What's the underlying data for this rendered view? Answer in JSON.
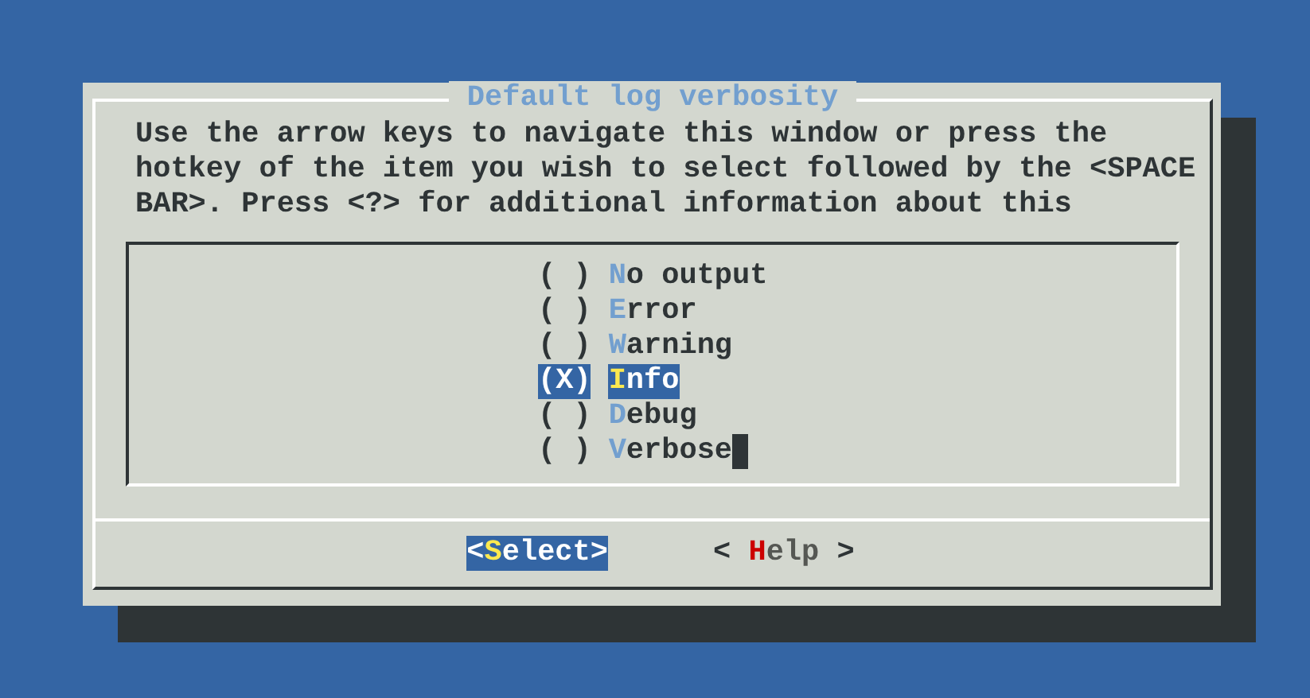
{
  "dialog": {
    "title": "Default log verbosity",
    "instructions": [
      "Use the arrow keys to navigate this window or press the",
      "hotkey of the item you wish to select followed by the <SPACE",
      "BAR>. Press <?> for additional information about this"
    ],
    "items": [
      {
        "marker": "( )",
        "label": "No output",
        "selected": false
      },
      {
        "marker": "( )",
        "label": "Error",
        "selected": false
      },
      {
        "marker": "( )",
        "label": "Warning",
        "selected": false
      },
      {
        "marker": "(X)",
        "label": "Info",
        "selected": true
      },
      {
        "marker": "( )",
        "label": "Debug",
        "selected": false
      },
      {
        "marker": "( )",
        "label": "Verbose",
        "selected": false,
        "cursor": true
      }
    ],
    "buttons": [
      {
        "open": "<",
        "label": "Select",
        "close": ">",
        "selected": true
      },
      {
        "open": "< ",
        "label": "Help",
        "close": " >",
        "selected": false
      }
    ]
  }
}
